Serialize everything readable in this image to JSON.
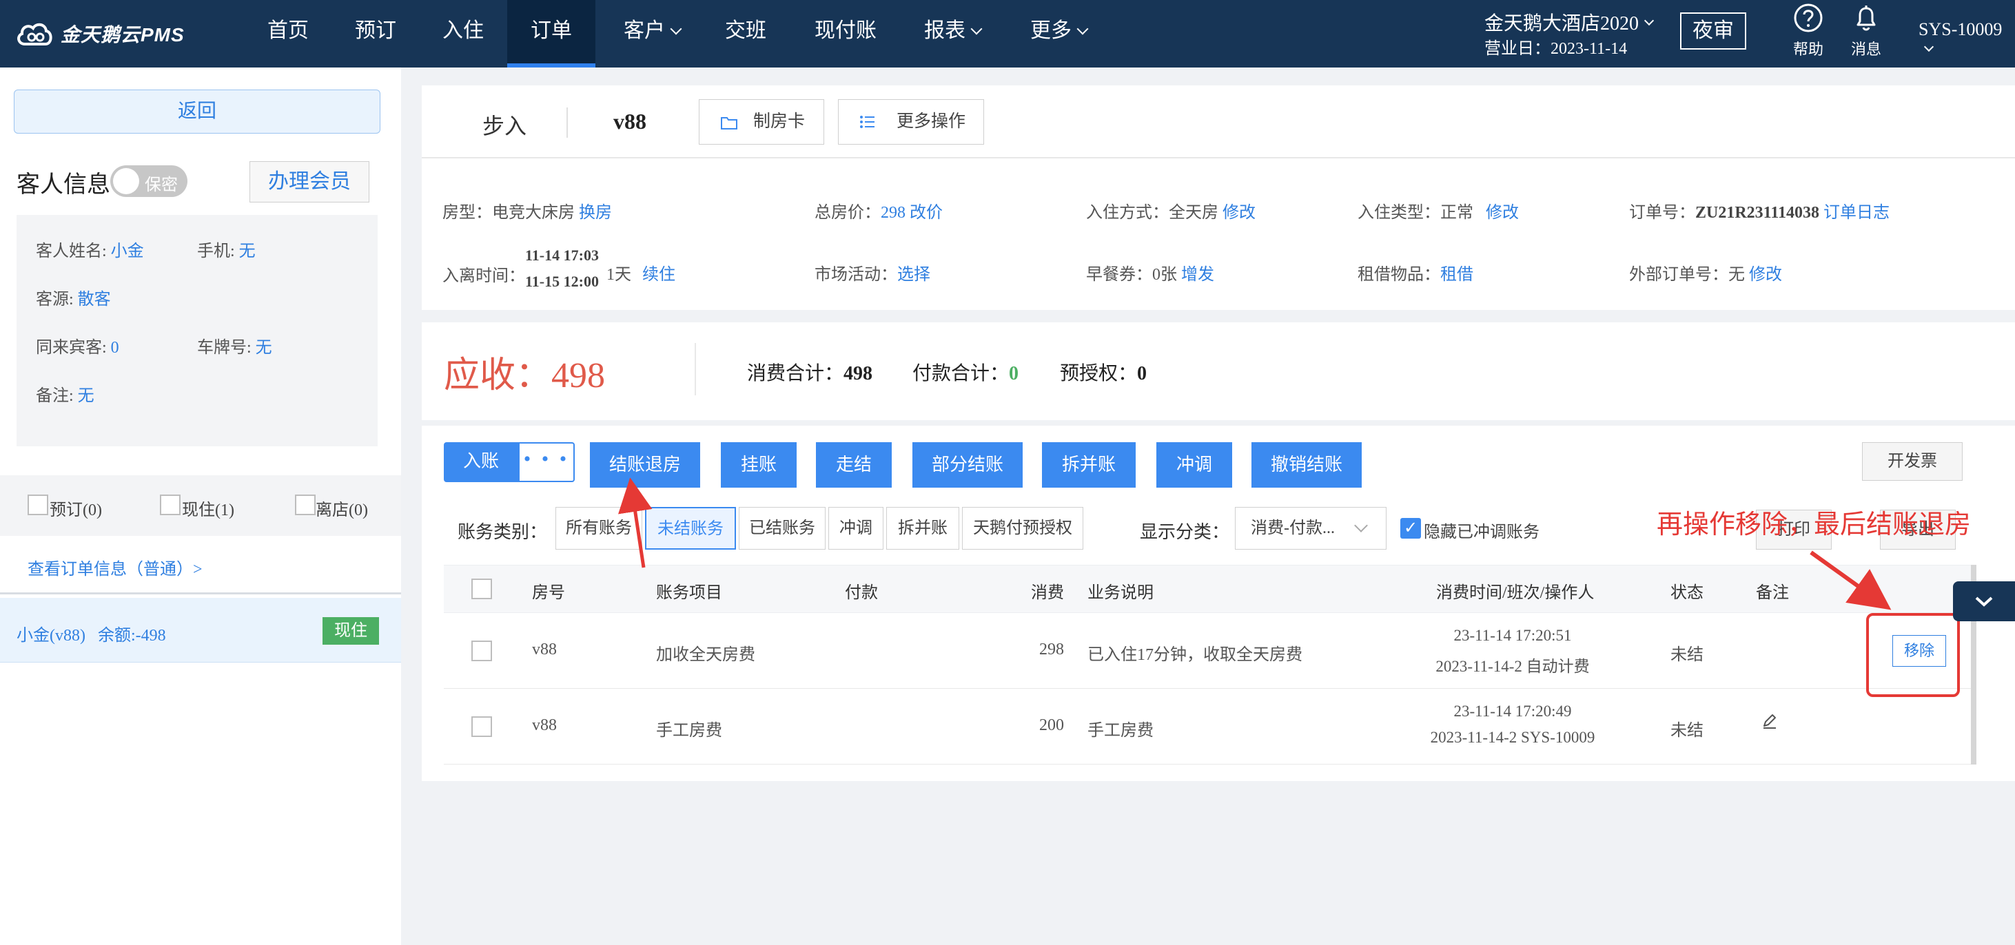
{
  "nav": {
    "logo_text": "金天鹅云PMS",
    "items": [
      {
        "label": "首页"
      },
      {
        "label": "预订"
      },
      {
        "label": "入住"
      },
      {
        "label": "订单"
      },
      {
        "label": "客户"
      },
      {
        "label": "交班"
      },
      {
        "label": "现付账"
      },
      {
        "label": "报表"
      },
      {
        "label": "更多"
      }
    ],
    "hotel": "金天鹅大酒店2020",
    "business_date": "营业日：2023-11-14",
    "night_audit": "夜审",
    "help": "帮助",
    "messages": "消息",
    "user": "SYS-10009"
  },
  "left": {
    "back": "返回",
    "guest_info_title": "客人信息",
    "privacy_toggle": "保密",
    "member_button": "办理会员",
    "guest_name_label": "客人姓名:",
    "guest_name": "小金",
    "phone_label": "手机:",
    "phone": "无",
    "source_label": "客源:",
    "source": "散客",
    "companions_label": "同来宾客:",
    "companions": "0",
    "plate_label": "车牌号:",
    "plate": "无",
    "remark_label": "备注:",
    "remark": "无",
    "tabs": [
      {
        "label": "预订(0)"
      },
      {
        "label": "现住(1)"
      },
      {
        "label": "离店(0)"
      }
    ],
    "view_order": "查看订单信息（普通）>",
    "room_item": "小金(v88)   余额:-498",
    "room_badge": "现住"
  },
  "header": {
    "step_in": "步入",
    "room": "v88",
    "make_card": "制房卡",
    "more_ops": "更多操作"
  },
  "info": {
    "room_type_label": "房型：",
    "room_type": "电竞大床房",
    "change_room": "换房",
    "total_price_label": "总房价：",
    "total_price": "298",
    "change_price": "改价",
    "checkin_method_label": "入住方式：",
    "checkin_method": "全天房",
    "modify": "修改",
    "checkin_type_label": "入住类型：",
    "checkin_type": "正常",
    "order_no_label": "订单号：",
    "order_no": "ZU21R231114038",
    "order_log": "订单日志",
    "stay_label": "入离时间：",
    "arrive": "11-14 17:03",
    "depart": "11-15 12:00",
    "nights": "1天",
    "extend": "续住",
    "market_label": "市场活动：",
    "market": "选择",
    "breakfast_label": "早餐券：",
    "breakfast": "0张",
    "breakfast_add": "增发",
    "rental_label": "租借物品：",
    "rental": "租借",
    "ext_order_label": "外部订单号：",
    "ext_order": "无",
    "ext_modify": "修改"
  },
  "summary": {
    "receivable": "应收：498",
    "consume_label": "消费合计：",
    "consume": "498",
    "payment_label": "付款合计：",
    "payment": "0",
    "preauth_label": "预授权：",
    "preauth": "0"
  },
  "actions": {
    "post": "入账",
    "post_more": "• • •",
    "buttons": [
      {
        "label": "结账退房"
      },
      {
        "label": "挂账"
      },
      {
        "label": "走结"
      },
      {
        "label": "部分结账"
      },
      {
        "label": "拆并账"
      },
      {
        "label": "冲调"
      },
      {
        "label": "撤销结账"
      }
    ],
    "invoice": "开发票"
  },
  "filters": {
    "category_label": "账务类别：",
    "options": [
      {
        "label": "所有账务"
      },
      {
        "label": "未结账务"
      },
      {
        "label": "已结账务"
      },
      {
        "label": "冲调"
      },
      {
        "label": "拆并账"
      },
      {
        "label": "天鹅付预授权"
      }
    ],
    "selected": "未结账务",
    "display_label": "显示分类：",
    "display_value": "消费-付款...",
    "hide_reversed": "隐藏已冲调账务",
    "print": "打印",
    "export": "导出"
  },
  "table": {
    "columns": [
      "房号",
      "账务项目",
      "付款",
      "消费",
      "业务说明",
      "消费时间/班次/操作人",
      "状态",
      "备注"
    ],
    "rows": [
      {
        "room": "v88",
        "item": "加收全天房费",
        "payment": "",
        "consume": "298",
        "desc": "已入住17分钟，收取全天房费",
        "time": "23-11-14 17:20:51",
        "shift": "2023-11-14-2 自动计费",
        "status": "未结",
        "action": "移除"
      },
      {
        "room": "v88",
        "item": "手工房费",
        "payment": "",
        "consume": "200",
        "desc": "手工房费",
        "time": "23-11-14 17:20:49",
        "shift": "2023-11-14-2 SYS-10009",
        "status": "未结"
      }
    ]
  },
  "annotation": {
    "text": "再操作移除，最后结账退房",
    "color": "#e53935"
  },
  "colors": {
    "nav_bg": "#173556",
    "accent": "#3b8af0",
    "receivable": "#e05a4a",
    "badge_green": "#4caf63"
  }
}
